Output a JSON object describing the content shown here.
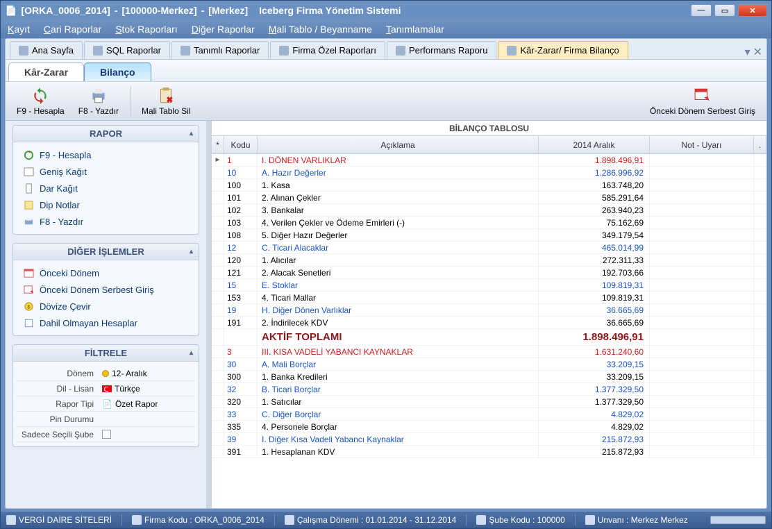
{
  "title": {
    "p1": "[ORKA_0006_2014]",
    "sep1": "-",
    "p2": "[100000-Merkez]",
    "sep2": "-",
    "p3": "[Merkez]",
    "app": "Iceberg Firma Yönetim Sistemi"
  },
  "menu": [
    "Kayıt",
    "Cari Raporlar",
    "Stok Raporları",
    "Diğer Raporlar",
    "Mali Tablo / Beyanname",
    "Tanımlamalar"
  ],
  "tabs": [
    {
      "label": "Ana Sayfa"
    },
    {
      "label": "SQL Raporlar"
    },
    {
      "label": "Tanımlı Raporlar"
    },
    {
      "label": "Firma Özel Raporları"
    },
    {
      "label": "Performans Raporu"
    },
    {
      "label": "Kâr-Zarar/ Firma Bilanço",
      "active": true
    }
  ],
  "subtabs": {
    "left": "Kâr-Zarar",
    "right": "Bilanço"
  },
  "ribbon": {
    "hesapla": "F9 - Hesapla",
    "yazdir": "F8 - Yazdır",
    "sil": "Mali Tablo Sil",
    "onceki": "Önceki Dönem Serbest Giriş"
  },
  "panels": {
    "rapor": {
      "title": "RAPOR",
      "items": [
        "F9 - Hesapla",
        "Geniş Kağıt",
        "Dar Kağıt",
        "Dip Notlar",
        "F8 - Yazdır"
      ]
    },
    "diger": {
      "title": "DİĞER İŞLEMLER",
      "items": [
        "Önceki Dönem",
        "Önceki Dönem Serbest Giriş",
        "Dövize Çevir",
        "Dahil Olmayan Hesaplar"
      ]
    },
    "filtre": {
      "title": "FİLTRELE",
      "rows": [
        {
          "lbl": "Dönem",
          "val": "12- Aralık",
          "kind": "dot"
        },
        {
          "lbl": "Dil - Lisan",
          "val": "Türkçe",
          "kind": "flag"
        },
        {
          "lbl": "Rapor Tipi",
          "val": "Özet Rapor",
          "kind": "doc"
        },
        {
          "lbl": "Pin Durumu",
          "val": "",
          "kind": ""
        },
        {
          "lbl": "Sadece Seçili Şube",
          "val": "",
          "kind": "chk"
        }
      ]
    }
  },
  "grid": {
    "title": "BİLANÇO TABLOSU",
    "headers": {
      "kod": "Kodu",
      "acik": "Açıklama",
      "val": "2014 Aralık",
      "not": "Not - Uyarı"
    },
    "rows": [
      {
        "k": "1",
        "a": "I. DÖNEN VARLIKLAR",
        "v": "1.898.496,91",
        "style": "red",
        "mark": "►"
      },
      {
        "k": "10",
        "a": "A. Hazır Değerler",
        "v": "1.286.996,92",
        "style": "blue"
      },
      {
        "k": "100",
        "a": "1. Kasa",
        "v": "163.748,20"
      },
      {
        "k": "101",
        "a": "2. Alınan Çekler",
        "v": "585.291,64"
      },
      {
        "k": "102",
        "a": "3. Bankalar",
        "v": "263.940,23"
      },
      {
        "k": "103",
        "a": "4. Verilen Çekler ve Ödeme Emirleri (-)",
        "v": "75.162,69"
      },
      {
        "k": "108",
        "a": "5. Diğer Hazır Değerler",
        "v": "349.179,54"
      },
      {
        "k": "12",
        "a": "C. Ticari Alacaklar",
        "v": "465.014,99",
        "style": "blue"
      },
      {
        "k": "120",
        "a": "1. Alıcılar",
        "v": "272.311,33"
      },
      {
        "k": "121",
        "a": "2. Alacak Senetleri",
        "v": "192.703,66"
      },
      {
        "k": "15",
        "a": "E. Stoklar",
        "v": "109.819,31",
        "style": "blue"
      },
      {
        "k": "153",
        "a": "4. Ticari Mallar",
        "v": "109.819,31"
      },
      {
        "k": "19",
        "a": "H. Diğer Dönen Varlıklar",
        "v": "36.665,69",
        "style": "blue"
      },
      {
        "k": "191",
        "a": "2. İndirilecek KDV",
        "v": "36.665,69"
      },
      {
        "k": "",
        "a": "AKTİF TOPLAMI",
        "v": "1.898.496,91",
        "style": "total"
      },
      {
        "k": "3",
        "a": "III. KISA VADELİ YABANCI KAYNAKLAR",
        "v": "1.631.240,60",
        "style": "red"
      },
      {
        "k": "30",
        "a": "A. Mali Borçlar",
        "v": "33.209,15",
        "style": "blue"
      },
      {
        "k": "300",
        "a": "1. Banka Kredileri",
        "v": "33.209,15"
      },
      {
        "k": "32",
        "a": "B. Ticari Borçlar",
        "v": "1.377.329,50",
        "style": "blue"
      },
      {
        "k": "320",
        "a": "1. Satıcılar",
        "v": "1.377.329,50"
      },
      {
        "k": "33",
        "a": "C. Diğer Borçlar",
        "v": "4.829,02",
        "style": "blue"
      },
      {
        "k": "335",
        "a": "4. Personele Borçlar",
        "v": "4.829,02"
      },
      {
        "k": "39",
        "a": "I. Diğer Kısa Vadeli Yabancı Kaynaklar",
        "v": "215.872,93",
        "style": "blue"
      },
      {
        "k": "391",
        "a": "1. Hesaplanan KDV",
        "v": "215.872,93"
      }
    ]
  },
  "status": {
    "s1": "VERGİ DAİRE SİTELERİ",
    "s2": "Firma Kodu : ORKA_0006_2014",
    "s3": "Çalışma Dönemi : 01.01.2014 - 31.12.2014",
    "s4": "Şube Kodu : 100000",
    "s5": "Unvanı : Merkez Merkez"
  }
}
